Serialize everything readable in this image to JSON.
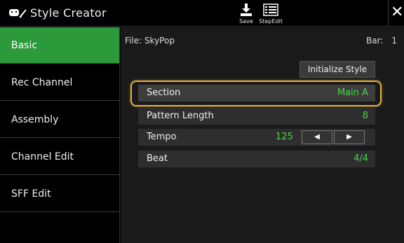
{
  "app": {
    "title": "Style Creator",
    "save_label": "Save",
    "stepedit_label": "StepEdit",
    "close_glyph": "✕"
  },
  "sidebar": {
    "tabs": [
      {
        "label": "Basic",
        "active": true
      },
      {
        "label": "Rec Channel",
        "active": false
      },
      {
        "label": "Assembly",
        "active": false
      },
      {
        "label": "Channel Edit",
        "active": false
      },
      {
        "label": "SFF Edit",
        "active": false
      }
    ]
  },
  "main": {
    "file_label": "File: SkyPop",
    "bar_label": "Bar:",
    "bar_value": "1",
    "initialize_label": "Initialize Style",
    "rows": {
      "section": {
        "label": "Section",
        "value": "Main A"
      },
      "pattern_length": {
        "label": "Pattern Length",
        "value": "8"
      },
      "tempo": {
        "label": "Tempo",
        "value": "125",
        "dec_glyph": "◀",
        "inc_glyph": "▶"
      },
      "beat": {
        "label": "Beat",
        "value": "4/4"
      }
    }
  },
  "colors": {
    "active_tab": "#2c9a3b",
    "value_green": "#4fd14a",
    "highlight": "#e6b23f"
  },
  "icons": [
    "style-creator-icon",
    "save-icon",
    "stepedit-icon",
    "close-icon",
    "triangle-left-icon",
    "triangle-right-icon"
  ]
}
